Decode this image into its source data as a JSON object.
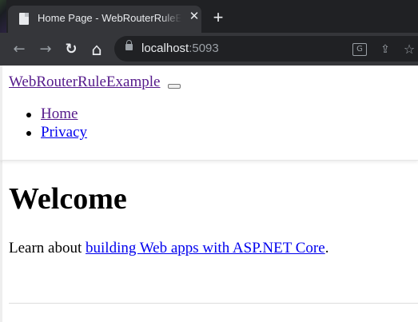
{
  "browser": {
    "tab_title": "Home Page - WebRouterRuleExample",
    "close_glyph": "✕",
    "new_tab_glyph": "+",
    "url_host": "localhost",
    "url_port": ":5093",
    "icons": {
      "favicon": "page-icon",
      "back": "back-arrow-icon",
      "forward": "forward-arrow-icon",
      "reload": "reload-icon",
      "home": "home-icon",
      "lock": "lock-icon",
      "translate": "translate-icon",
      "share": "share-icon",
      "bookmark": "star-icon"
    },
    "glyphs": {
      "back": "←",
      "forward": "→",
      "reload": "↻",
      "home": "⌂",
      "translate": "G",
      "share": "⇪",
      "bookmark": "☆"
    },
    "colors": {
      "tabstrip": "#202124",
      "toolbar": "#35363a",
      "text": "#e8eaed"
    }
  },
  "site": {
    "brand": "WebRouterRuleExample",
    "nav": [
      {
        "label": "Home"
      },
      {
        "label": "Privacy"
      }
    ]
  },
  "main": {
    "heading": "Welcome",
    "learn_prefix": "Learn about ",
    "learn_link": "building Web apps with ASP.NET Core",
    "learn_suffix": "."
  }
}
